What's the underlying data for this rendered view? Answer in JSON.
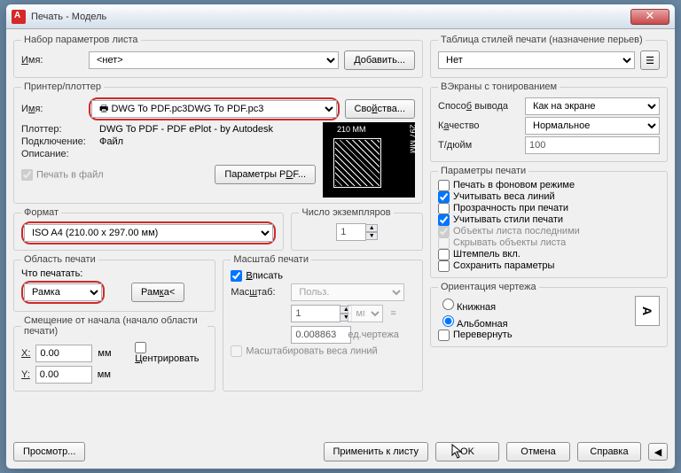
{
  "title": "Печать - Модель",
  "pageSetup": {
    "legend": "Набор параметров листа",
    "nameLabel": "Имя:",
    "nameValue": "<нет>",
    "addBtn": "Добавить..."
  },
  "printer": {
    "legend": "Принтер/плоттер",
    "nameLabel": "Имя:",
    "nameValue": "DWG To PDF.pc3",
    "propsBtn": "Свойства...",
    "plotterLabel": "Плоттер:",
    "plotterValue": "DWG To PDF - PDF ePlot - by Autodesk",
    "connLabel": "Подключение:",
    "connValue": "Файл",
    "descLabel": "Описание:",
    "printToFile": "Печать в файл",
    "pdfParams": "Параметры PDF...",
    "previewW": "210 MM",
    "previewH": "297 MM"
  },
  "format": {
    "legend": "Формат",
    "value": "ISO A4 (210.00 x 297.00 мм)"
  },
  "copies": {
    "legend": "Число экземпляров",
    "value": "1"
  },
  "area": {
    "legend": "Область печати",
    "whatLabel": "Что печатать:",
    "value": "Рамка",
    "frameBtn": "Рамка<"
  },
  "scale": {
    "legend": "Масштаб печати",
    "fit": "Вписать",
    "scaleLabel": "Масштаб:",
    "scaleValue": "Польз.",
    "num": "1",
    "unit": "мм",
    "eq": "=",
    "den": "0.008863",
    "unitDraw": "ед.чертежа",
    "scaleWeights": "Масштабировать веса линий"
  },
  "offset": {
    "legend": "Смещение от начала (начало области печати)",
    "xLabel": "X:",
    "xVal": "0.00",
    "yLabel": "Y:",
    "yVal": "0.00",
    "mm": "мм",
    "center": "Центрировать"
  },
  "styles": {
    "legend": "Таблица стилей печати (назначение перьев)",
    "value": "Нет"
  },
  "viewports": {
    "legend": "ВЭкраны с тонированием",
    "outLabel": "Способ вывода",
    "outValue": "Как на экране",
    "qualLabel": "Качество",
    "qualValue": "Нормальное",
    "dpiLabel": "Т/дюйм",
    "dpiValue": "100"
  },
  "options": {
    "legend": "Параметры печати",
    "bg": "Печать в фоновом режиме",
    "weights": "Учитывать веса линий",
    "transp": "Прозрачность при печати",
    "useStyles": "Учитывать стили печати",
    "paperLast": "Объекты листа последними",
    "hide": "Скрывать объекты листа",
    "stamp": "Штемпель вкл.",
    "save": "Сохранить параметры"
  },
  "orient": {
    "legend": "Ориентация чертежа",
    "portrait": "Книжная",
    "landscape": "Альбомная",
    "upside": "Перевернуть"
  },
  "footer": {
    "preview": "Просмотр...",
    "applyLayout": "Применить к листу",
    "ok": "OK",
    "cancel": "Отмена",
    "help": "Справка"
  }
}
